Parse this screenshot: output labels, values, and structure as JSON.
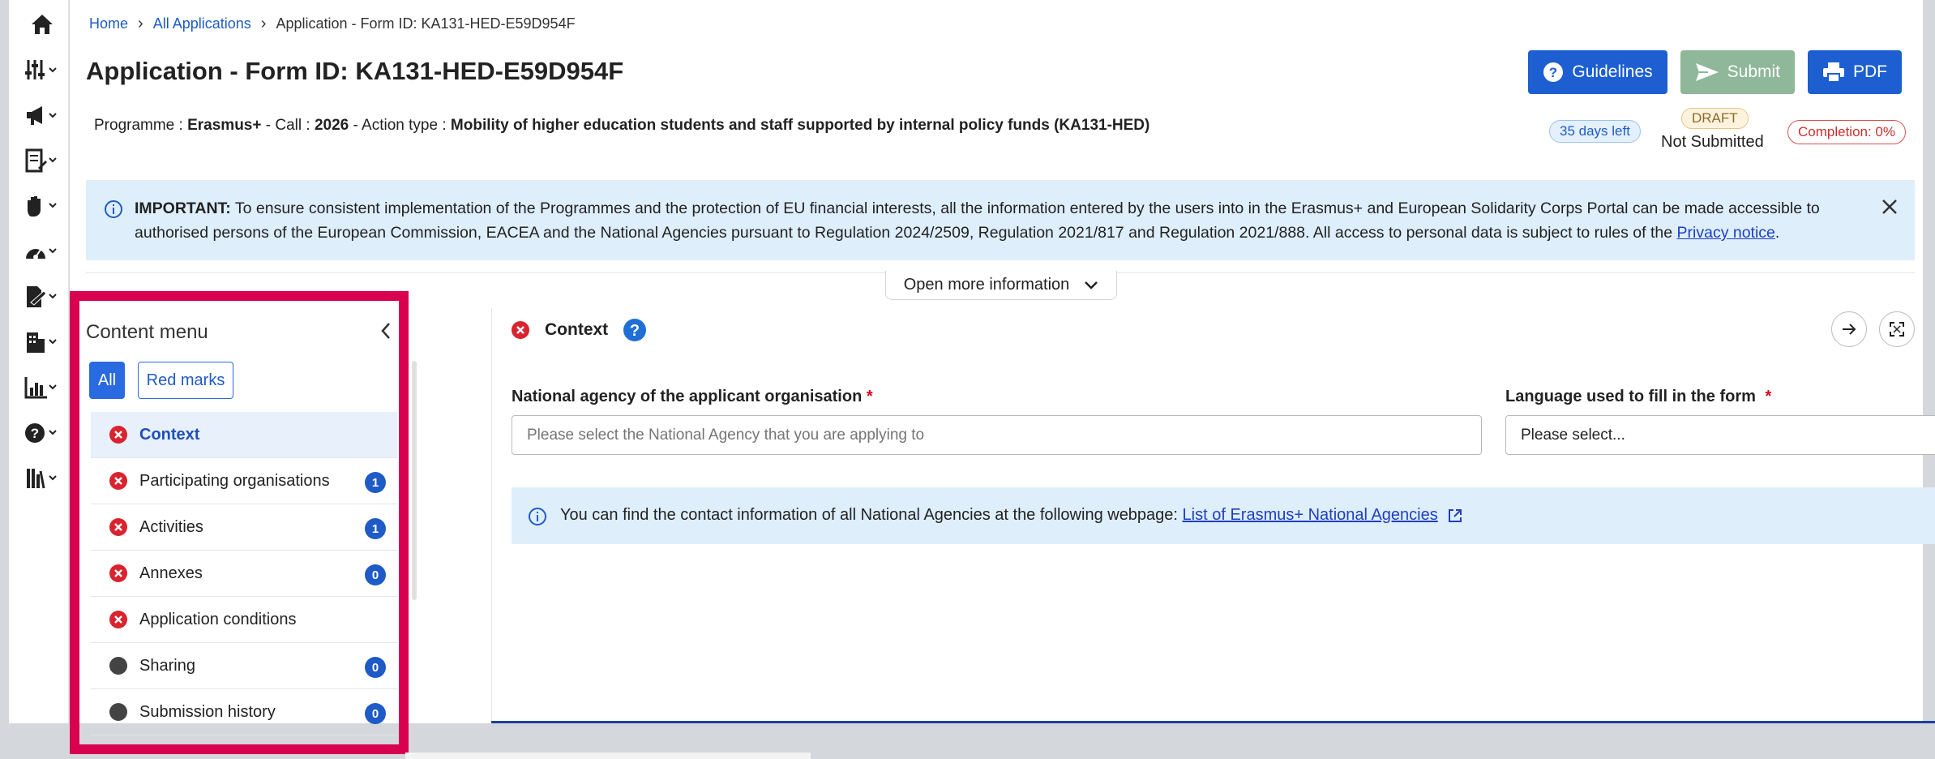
{
  "breadcrumb": {
    "home": "Home",
    "all_applications": "All Applications",
    "current": "Application - Form ID: KA131-HED-E59D954F"
  },
  "page_title": "Application - Form ID: KA131-HED-E59D954F",
  "actions": {
    "guidelines": "Guidelines",
    "submit": "Submit",
    "pdf": "PDF"
  },
  "programme": {
    "programme_label": "Programme :",
    "programme_value": "Erasmus+",
    "call_label": "- Call :",
    "call_value": "2026",
    "action_label": "- Action type :",
    "action_value": "Mobility of higher education students and staff supported by internal policy funds (KA131-HED)"
  },
  "status": {
    "days_left": "35 days left",
    "draft": "DRAFT",
    "submission": "Not Submitted",
    "completion": "Completion: 0%"
  },
  "notice": {
    "strong": "IMPORTANT:",
    "text": "To ensure consistent implementation of the Programmes and the protection of EU financial interests, all the information entered by the users into in the Erasmus+ and European Solidarity Corps Portal can be made accessible to authorised persons of the European Commission, EACEA and the National Agencies pursuant to Regulation 2024/2509, Regulation 2021/817 and Regulation 2021/888. All access to personal data is subject to rules of the",
    "link": "Privacy notice",
    "end": "."
  },
  "open_more": "Open more information",
  "content_menu": {
    "title": "Content menu",
    "filter_all": "All",
    "filter_red": "Red marks",
    "items": [
      {
        "label": "Context",
        "status": "error",
        "count": ""
      },
      {
        "label": "Participating organisations",
        "status": "error",
        "count": "1"
      },
      {
        "label": "Activities",
        "status": "error",
        "count": "1"
      },
      {
        "label": "Annexes",
        "status": "error",
        "count": "0"
      },
      {
        "label": "Application conditions",
        "status": "error",
        "count": ""
      },
      {
        "label": "Sharing",
        "status": "neutral",
        "count": "0"
      },
      {
        "label": "Submission history",
        "status": "neutral",
        "count": "0"
      }
    ]
  },
  "section": {
    "title": "Context",
    "national_agency_label": "National agency of the applicant organisation",
    "national_agency_placeholder": "Please select the National Agency that you are applying to",
    "language_label": "Language used to fill in the form",
    "language_value": "Please select...",
    "required_mark": "*",
    "info_text": "You can find the contact information of all National Agencies at the following webpage:",
    "info_link": "List of Erasmus+ National Agencies"
  },
  "colors": {
    "primary": "#1d5fd1",
    "error": "#d9232e",
    "highlight": "#d8004f",
    "info_bg": "#deeefb"
  }
}
